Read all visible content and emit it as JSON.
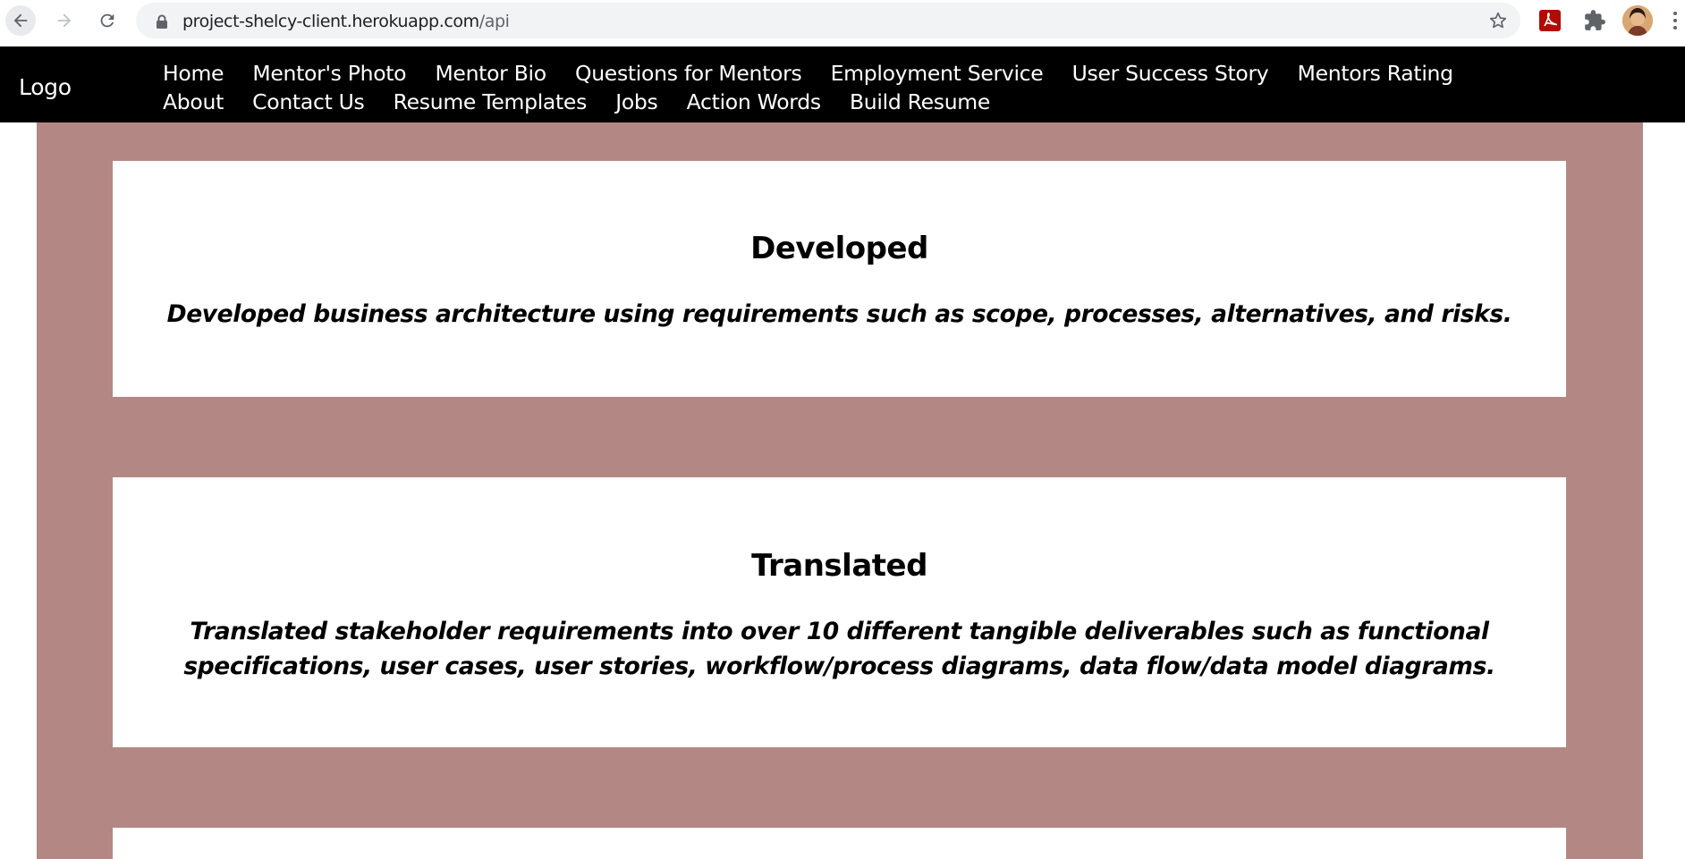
{
  "browser": {
    "url_host": "project-shelcy-client.herokuapp.com",
    "url_path": "/api"
  },
  "site": {
    "logo": "Logo",
    "nav": [
      "Home",
      "Mentor's Photo",
      "Mentor Bio",
      "Questions for Mentors",
      "Employment Service",
      "User Success Story",
      "Mentors Rating",
      "About",
      "Contact Us",
      "Resume Templates",
      "Jobs",
      "Action Words",
      "Build Resume"
    ]
  },
  "cards": [
    {
      "title": "Developed",
      "text": "Developed business architecture using requirements such as scope, processes, alternatives, and risks."
    },
    {
      "title": "Translated",
      "text": "Translated stakeholder requirements into over 10 different tangible deliverables such as functional specifications, user cases, user stories, workflow/process diagrams, data flow/data model diagrams."
    }
  ],
  "colors": {
    "nav_bg": "#000000",
    "page_bg": "#b38783",
    "card_bg": "#ffffff"
  }
}
